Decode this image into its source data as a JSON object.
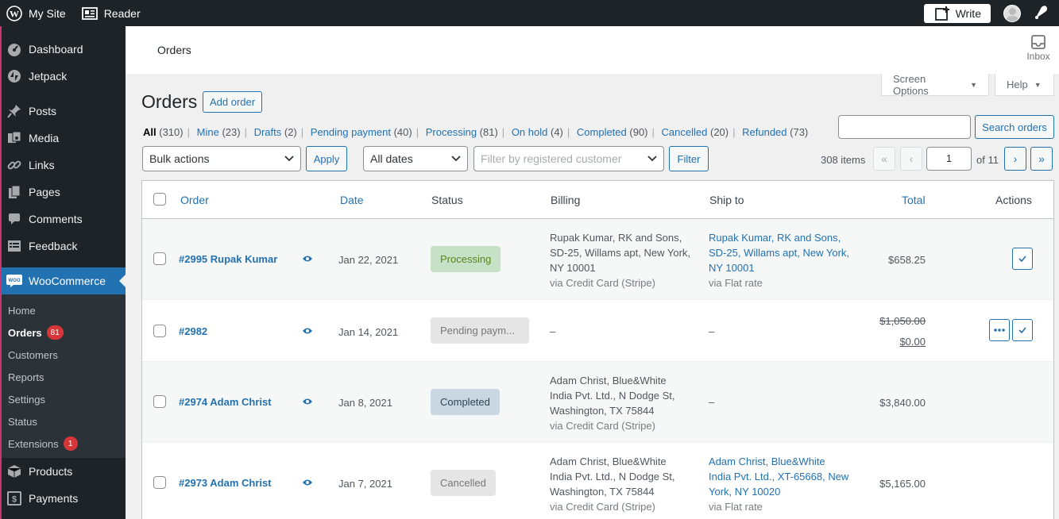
{
  "topbar": {
    "site": "My Site",
    "reader": "Reader",
    "write": "Write"
  },
  "sidebar": {
    "items_top": [
      "Dashboard",
      "Jetpack",
      "Posts",
      "Media",
      "Links",
      "Pages",
      "Comments",
      "Feedback"
    ],
    "woocommerce": "WooCommerce",
    "submenu": [
      {
        "label": "Home",
        "badge": ""
      },
      {
        "label": "Orders",
        "badge": "81"
      },
      {
        "label": "Customers",
        "badge": ""
      },
      {
        "label": "Reports",
        "badge": ""
      },
      {
        "label": "Settings",
        "badge": ""
      },
      {
        "label": "Status",
        "badge": ""
      },
      {
        "label": "Extensions",
        "badge": "1"
      }
    ],
    "items_bottom": [
      "Products",
      "Payments"
    ]
  },
  "header": {
    "breadcrumb": "Orders",
    "inbox": "Inbox",
    "screen_options": "Screen Options",
    "help": "Help"
  },
  "page": {
    "title": "Orders",
    "add_order": "Add order"
  },
  "filters": {
    "views": [
      {
        "label": "All",
        "count": "(310)"
      },
      {
        "label": "Mine",
        "count": "(23)"
      },
      {
        "label": "Drafts",
        "count": "(2)"
      },
      {
        "label": "Pending payment",
        "count": "(40)"
      },
      {
        "label": "Processing",
        "count": "(81)"
      },
      {
        "label": "On hold",
        "count": "(4)"
      },
      {
        "label": "Completed",
        "count": "(90)"
      },
      {
        "label": "Cancelled",
        "count": "(20)"
      },
      {
        "label": "Refunded",
        "count": "(73)"
      }
    ],
    "search_value": "",
    "search_button": "Search orders",
    "bulk_actions": "Bulk actions",
    "apply": "Apply",
    "all_dates": "All dates",
    "customer_placeholder": "Filter by registered customer",
    "filter": "Filter"
  },
  "pagination": {
    "items": "308 items",
    "first": "«",
    "prev": "‹",
    "current": "1",
    "of": "of 11",
    "next": "›",
    "last": "»"
  },
  "table": {
    "headers": {
      "order": "Order",
      "date": "Date",
      "status": "Status",
      "billing": "Billing",
      "ship_to": "Ship to",
      "total": "Total",
      "actions": "Actions"
    },
    "rows": [
      {
        "order": "#2995 Rupak Kumar",
        "date": "Jan 22, 2021",
        "status": "Processing",
        "billing": [
          "Rupak Kumar, RK and Sons,",
          "SD-25, Willams apt, New York,",
          "NY 10001"
        ],
        "billing_via": "via Credit Card (Stripe)",
        "ship": [
          "Rupak Kumar, RK and Sons,",
          "SD-25, Willams apt, New York,",
          "NY 10001"
        ],
        "ship_via": "via Flat rate",
        "total": "$658.25"
      },
      {
        "order": "#2982",
        "date": "Jan 14, 2021",
        "status": "Pending paym...",
        "billing_dash": "–",
        "ship_dash": "–",
        "total_old": "$1,050.00",
        "total": "$0.00"
      },
      {
        "order": "#2974 Adam Christ",
        "date": "Jan 8, 2021",
        "status": "Completed",
        "billing": [
          "Adam Christ, Blue&White",
          "India Pvt. Ltd., N Dodge St,",
          "Washington, TX 75844"
        ],
        "billing_via": "via Credit Card (Stripe)",
        "ship_dash": "–",
        "total": "$3,840.00"
      },
      {
        "order": "#2973 Adam Christ",
        "date": "Jan 7, 2021",
        "status": "Cancelled",
        "billing": [
          "Adam Christ, Blue&White",
          "India Pvt. Ltd., N Dodge St,",
          "Washington, TX 75844"
        ],
        "billing_via": "via Credit Card (Stripe)",
        "ship": [
          "Adam Christ, Blue&White",
          "India Pvt. Ltd., XT-65668, New",
          "York, NY 10020"
        ],
        "ship_via": "via Flat rate",
        "total": "$5,165.00"
      }
    ]
  }
}
